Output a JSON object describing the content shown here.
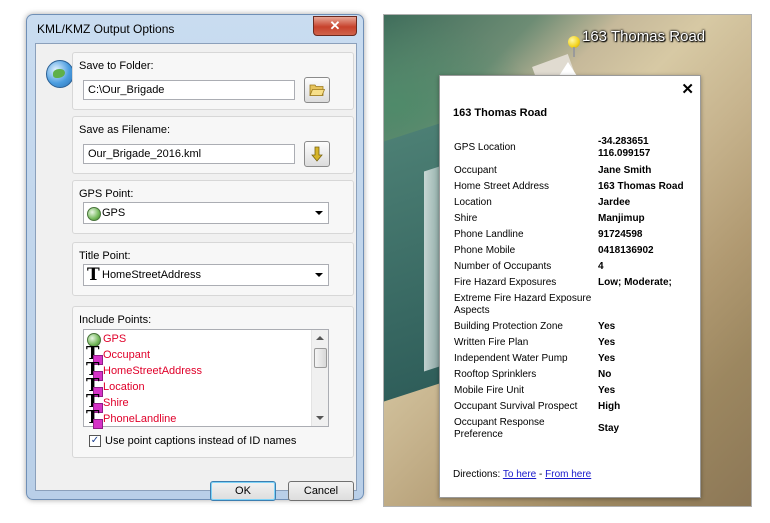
{
  "dialog": {
    "title": "KML/KMZ Output Options",
    "close_glyph": "✕",
    "save_folder": {
      "label": "Save to Folder:",
      "value": "C:\\Our_Brigade",
      "icon": "folder-open-icon"
    },
    "save_filename": {
      "label": "Save as Filename:",
      "value": "Our_Brigade_2016.kml",
      "icon": "down-arrow-icon"
    },
    "gps_point": {
      "label": "GPS Point:",
      "value": "GPS",
      "icon": "gps-globe-icon"
    },
    "title_point": {
      "label": "Title Point:",
      "value": "HomeStreetAddress",
      "icon": "text-T-icon"
    },
    "include_points": {
      "label": "Include Points:",
      "items": [
        "GPS",
        "Occupant",
        "HomeStreetAddress",
        "Location",
        "Shire",
        "PhoneLandline"
      ]
    },
    "use_captions": {
      "label": "Use point captions instead of ID names",
      "checked": true,
      "check_glyph": "✓"
    },
    "ok_label": "OK",
    "cancel_label": "Cancel",
    "colors": {
      "list_text": "#e0002a",
      "title_bar": "#c9dcf0",
      "close_button": "#c7422c"
    }
  },
  "map": {
    "place_label": "163 Thomas Road",
    "popup": {
      "close_glyph": "✕",
      "title": "163 Thomas Road",
      "rows": [
        {
          "k": "GPS Location",
          "v": "-34.283651\n116.099157"
        },
        {
          "k": "Occupant",
          "v": "Jane Smith"
        },
        {
          "k": "Home Street Address",
          "v": "163 Thomas Road"
        },
        {
          "k": "Location",
          "v": "Jardee"
        },
        {
          "k": "Shire",
          "v": "Manjimup"
        },
        {
          "k": "Phone Landline",
          "v": "91724598"
        },
        {
          "k": "Phone Mobile",
          "v": "0418136902"
        },
        {
          "k": "Number of Occupants",
          "v": "4"
        },
        {
          "k": "Fire Hazard Exposures",
          "v": "Low; Moderate;"
        },
        {
          "k": "Extreme Fire Hazard Exposure Aspects",
          "v": ""
        },
        {
          "k": "Building Protection Zone",
          "v": "Yes"
        },
        {
          "k": "Written Fire Plan",
          "v": "Yes"
        },
        {
          "k": "Independent Water Pump",
          "v": "Yes"
        },
        {
          "k": "Rooftop Sprinklers",
          "v": "No"
        },
        {
          "k": "Mobile Fire Unit",
          "v": "Yes"
        },
        {
          "k": "Occupant Survival Prospect",
          "v": "High"
        },
        {
          "k": "Occupant Response Preference",
          "v": "Stay"
        }
      ],
      "directions_label": "Directions:",
      "to_here": "To here",
      "separator": "-",
      "from_here": "From here"
    }
  }
}
